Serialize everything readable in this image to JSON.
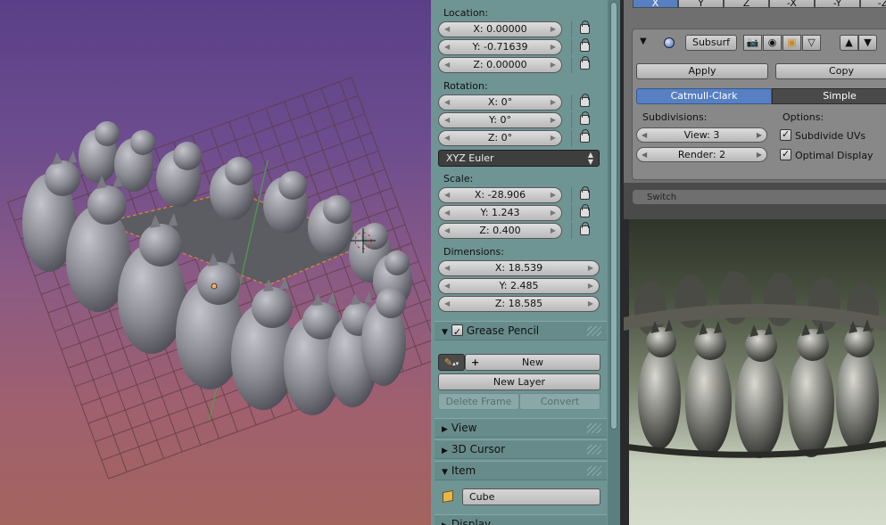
{
  "properties": {
    "location": {
      "label": "Location:",
      "x": "X: 0.00000",
      "y": "Y: -0.71639",
      "z": "Z: 0.00000"
    },
    "rotation": {
      "label": "Rotation:",
      "x": "X: 0°",
      "y": "Y: 0°",
      "z": "Z: 0°",
      "mode": "XYZ Euler"
    },
    "scale": {
      "label": "Scale:",
      "x": "X: -28.906",
      "y": "Y: 1.243",
      "z": "Z: 0.400"
    },
    "dimensions": {
      "label": "Dimensions:",
      "x": "X: 18.539",
      "y": "Y: 2.485",
      "z": "Z: 18.585"
    },
    "grease_pencil": {
      "title": "Grease Pencil",
      "enabled": true,
      "new_label": "New",
      "new_layer_label": "New Layer",
      "delete_frame_label": "Delete Frame",
      "convert_label": "Convert"
    },
    "panels": {
      "view": "View",
      "cursor": "3D Cursor",
      "item": "Item",
      "display": "Display"
    },
    "item_name": "Cube"
  },
  "modifier": {
    "axis_buttons": [
      "X",
      "Y",
      "Z",
      "-X",
      "-Y",
      "-Z"
    ],
    "active_axis": "X",
    "name": "Subsurf",
    "apply_label": "Apply",
    "copy_label": "Copy",
    "type_options": [
      "Catmull-Clark",
      "Simple"
    ],
    "active_type": "Catmull-Clark",
    "subdivisions_label": "Subdivisions:",
    "view_value": "View: 3",
    "render_value": "Render: 2",
    "options_label": "Options:",
    "subdivide_uvs_label": "Subdivide UVs",
    "subdivide_uvs": true,
    "optimal_display_label": "Optimal Display",
    "optimal_display": true,
    "next_modifier_label": "Switch"
  },
  "colors": {
    "properties_bg": "#6f9494",
    "active_blue": "#5680c2",
    "viewport_top": "#5a3f88",
    "viewport_bottom": "#a3645e",
    "mesh_gray": "#8e8e96"
  },
  "icons": [
    "pencil-icon",
    "plus-icon",
    "lock-icon",
    "cube-icon",
    "eye-icon",
    "camera-icon",
    "sphere-icon"
  ]
}
